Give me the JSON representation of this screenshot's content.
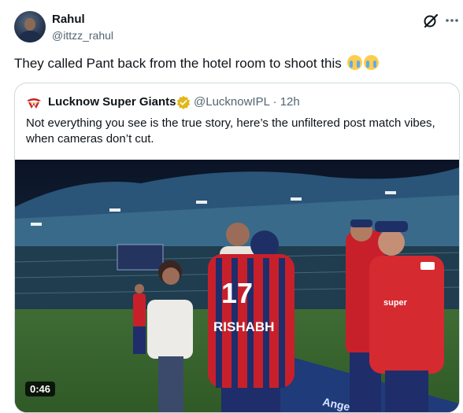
{
  "author": {
    "name": "Rahul",
    "handle": "@ittzz_rahul"
  },
  "tweet": {
    "text": "They called Pant back from the hotel room to shoot this"
  },
  "quote": {
    "name": "Lucknow Super Giants",
    "handle_time": "@LucknowIPL · 12h",
    "text": "Not everything you see is the true story, here’s the unfiltered post match vibes, when cameras don’t cut."
  },
  "video": {
    "duration": "0:46",
    "jersey_number": "17",
    "jersey_name": "RISHABH",
    "board_text": "AngelOne"
  },
  "icons": {
    "grok": "grok-icon",
    "more": "more-icon",
    "verified": "verified-badge-icon",
    "emoji": "loudly-crying-face-emoji"
  },
  "colors": {
    "verified": "#e2b719",
    "lsg_red": "#c8202b",
    "lsg_navy": "#1f2d6b"
  }
}
